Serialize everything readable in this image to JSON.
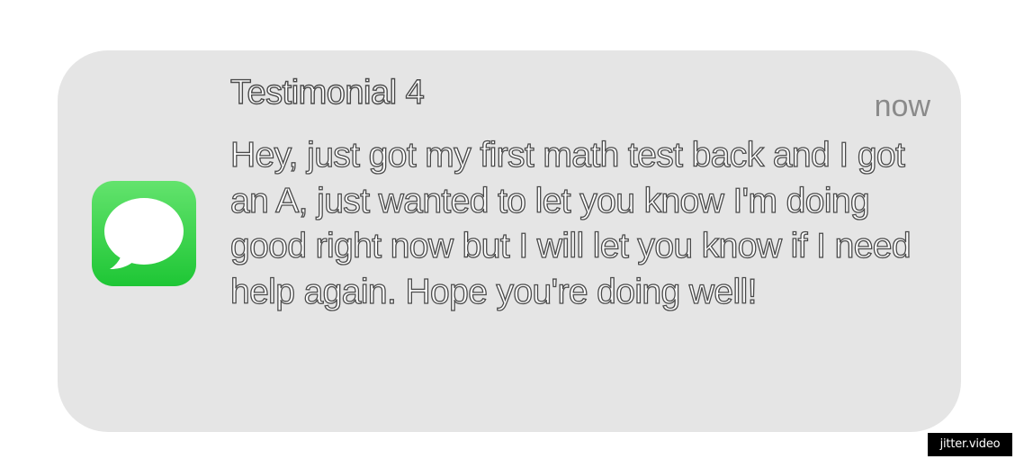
{
  "notification": {
    "title": "Testimonial 4",
    "timestamp": "now",
    "body": "Hey, just got my first math test back and I got an A, just wanted to let you know I'm doing good right now but I will let you know if I need help again. Hope you're doing well!",
    "app_icon": "messages-icon"
  },
  "watermark": {
    "text": "jitter.video"
  },
  "colors": {
    "card_background": "#e5e5e5",
    "icon_green_top": "#63e36d",
    "icon_green_bottom": "#1ec635",
    "timestamp": "#8a8a8a",
    "text_outline": "#4a4a4a"
  }
}
